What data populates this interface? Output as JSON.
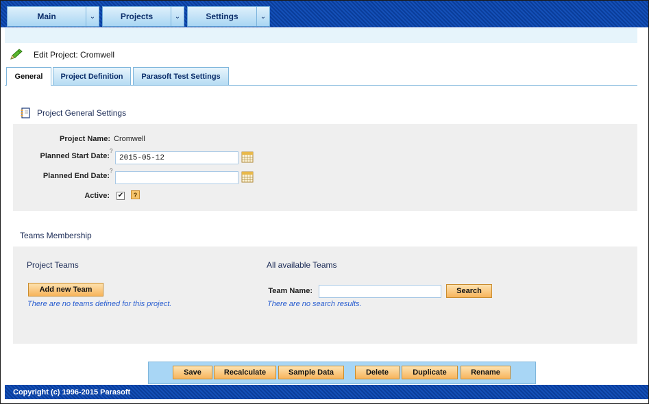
{
  "nav": {
    "menus": [
      {
        "label": "Main"
      },
      {
        "label": "Projects"
      },
      {
        "label": "Settings"
      }
    ]
  },
  "page": {
    "title": "Edit Project: Cromwell"
  },
  "tabs": [
    {
      "label": "General",
      "active": true
    },
    {
      "label": "Project Definition",
      "active": false
    },
    {
      "label": "Parasoft Test Settings",
      "active": false
    }
  ],
  "general_settings": {
    "heading": "Project General Settings",
    "project_name_label": "Project Name:",
    "project_name_value": "Cromwell",
    "start_date_label": "Planned Start Date:",
    "start_date_value": "2015-05-12",
    "end_date_label": "Planned End Date:",
    "end_date_value": "",
    "active_label": "Active:",
    "active_checked": true,
    "help_mark": "?",
    "superscript": "?"
  },
  "teams": {
    "heading": "Teams Membership",
    "project_teams_heading": "Project Teams",
    "add_team_button": "Add new Team",
    "no_teams_note": "There are no teams defined for this project.",
    "available_heading": "All available Teams",
    "team_name_label": "Team Name:",
    "team_name_value": "",
    "search_button": "Search",
    "no_results_note": "There are no search results."
  },
  "actions": {
    "save": "Save",
    "recalculate": "Recalculate",
    "sample_data": "Sample Data",
    "delete": "Delete",
    "duplicate": "Duplicate",
    "rename": "Rename"
  },
  "footer": {
    "copyright": "Copyright (c) 1996-2015 Parasoft"
  },
  "colors": {
    "nav_bar": "#1450b8",
    "button_orange": "#f7b45c",
    "tab_blue": "#b6dcf3",
    "note_blue": "#2b5fd0"
  }
}
